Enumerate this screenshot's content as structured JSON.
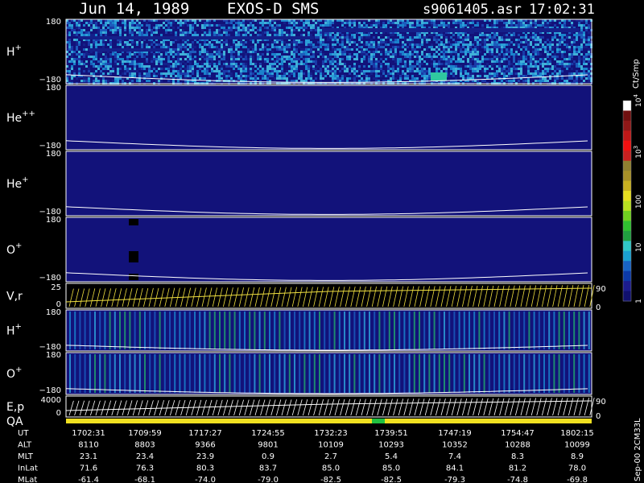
{
  "header": {
    "date": "Jun 14, 1989",
    "instrument": "EXOS-D SMS",
    "file": "s9061405.asr",
    "time": "17:02:31"
  },
  "colorbar": {
    "unit": "Ct/Smp",
    "ticks": [
      {
        "label": "1",
        "frac": 0.0
      },
      {
        "label": "10",
        "frac": 0.268
      },
      {
        "label": "100",
        "frac": 0.496
      },
      {
        "label": "10",
        "sup": "3",
        "frac": 0.744
      },
      {
        "label": "10",
        "sup": "4",
        "frac": 1.0
      }
    ],
    "colors": [
      "#10106e",
      "#1c1c8e",
      "#0c3aa8",
      "#1864c4",
      "#1aa0d0",
      "#30c8c8",
      "#20a040",
      "#30c030",
      "#70d020",
      "#b8e020",
      "#e8e020",
      "#c8b020",
      "#a89028",
      "#908030",
      "#c82020",
      "#f01010",
      "#c01818",
      "#901818",
      "#701010",
      "#ffffff"
    ]
  },
  "chart_data": [
    {
      "type": "heatmap",
      "panel": "H+",
      "label": "H",
      "sup": "+",
      "ylim": [
        -180,
        180
      ],
      "ytick_top": "180",
      "ytick_bottom": "−180"
    },
    {
      "type": "heatmap",
      "panel": "He++",
      "label": "He",
      "sup": "++",
      "ylim": [
        -180,
        180
      ],
      "ytick_top": "180",
      "ytick_bottom": "−180"
    },
    {
      "type": "heatmap",
      "panel": "He+",
      "label": "He",
      "sup": "+",
      "ylim": [
        -180,
        180
      ],
      "ytick_top": "180",
      "ytick_bottom": "−180"
    },
    {
      "type": "heatmap",
      "panel": "O+",
      "label": "O",
      "sup": "+",
      "ylim": [
        -180,
        180
      ],
      "ytick_top": "180",
      "ytick_bottom": "−180"
    },
    {
      "type": "line",
      "panel": "V,r",
      "label": "V,r",
      "yticks": [
        "25",
        "0"
      ],
      "right_ticks": [
        "90",
        "0"
      ]
    },
    {
      "type": "heatmap",
      "panel": "H+ (2)",
      "label": "H",
      "sup": "+",
      "ylim": [
        -180,
        180
      ],
      "ytick_top": "180",
      "ytick_bottom": "−180"
    },
    {
      "type": "heatmap",
      "panel": "O+ (2)",
      "label": "O",
      "sup": "+",
      "ylim": [
        -180,
        180
      ],
      "ytick_top": "180",
      "ytick_bottom": "−180"
    },
    {
      "type": "line",
      "panel": "E,p",
      "label": "E,p",
      "yticks": [
        "4000",
        "0"
      ],
      "right_ticks": [
        "90",
        "0"
      ]
    },
    {
      "type": "bar",
      "panel": "QA",
      "label": "QA"
    }
  ],
  "footer": {
    "rows": [
      {
        "label": "UT",
        "values": [
          "1702:31",
          "1709:59",
          "1717:27",
          "1724:55",
          "1732:23",
          "1739:51",
          "1747:19",
          "1754:47",
          "1802:15"
        ]
      },
      {
        "label": "ALT",
        "values": [
          "8110",
          "8803",
          "9366",
          "9801",
          "10109",
          "10293",
          "10352",
          "10288",
          "10099"
        ]
      },
      {
        "label": "MLT",
        "values": [
          "23.1",
          "23.4",
          "23.9",
          "0.9",
          "2.7",
          "5.4",
          "7.4",
          "8.3",
          "8.9"
        ]
      },
      {
        "label": "InLat",
        "values": [
          "71.6",
          "76.3",
          "80.3",
          "83.7",
          "85.0",
          "85.0",
          "84.1",
          "81.2",
          "78.0"
        ]
      },
      {
        "label": "MLat",
        "values": [
          "-61.4",
          "-68.1",
          "-74.0",
          "-79.0",
          "-82.5",
          "-82.5",
          "-79.3",
          "-74.8",
          "-69.8"
        ]
      }
    ],
    "side_label": "Sep-00  2CM33L"
  }
}
